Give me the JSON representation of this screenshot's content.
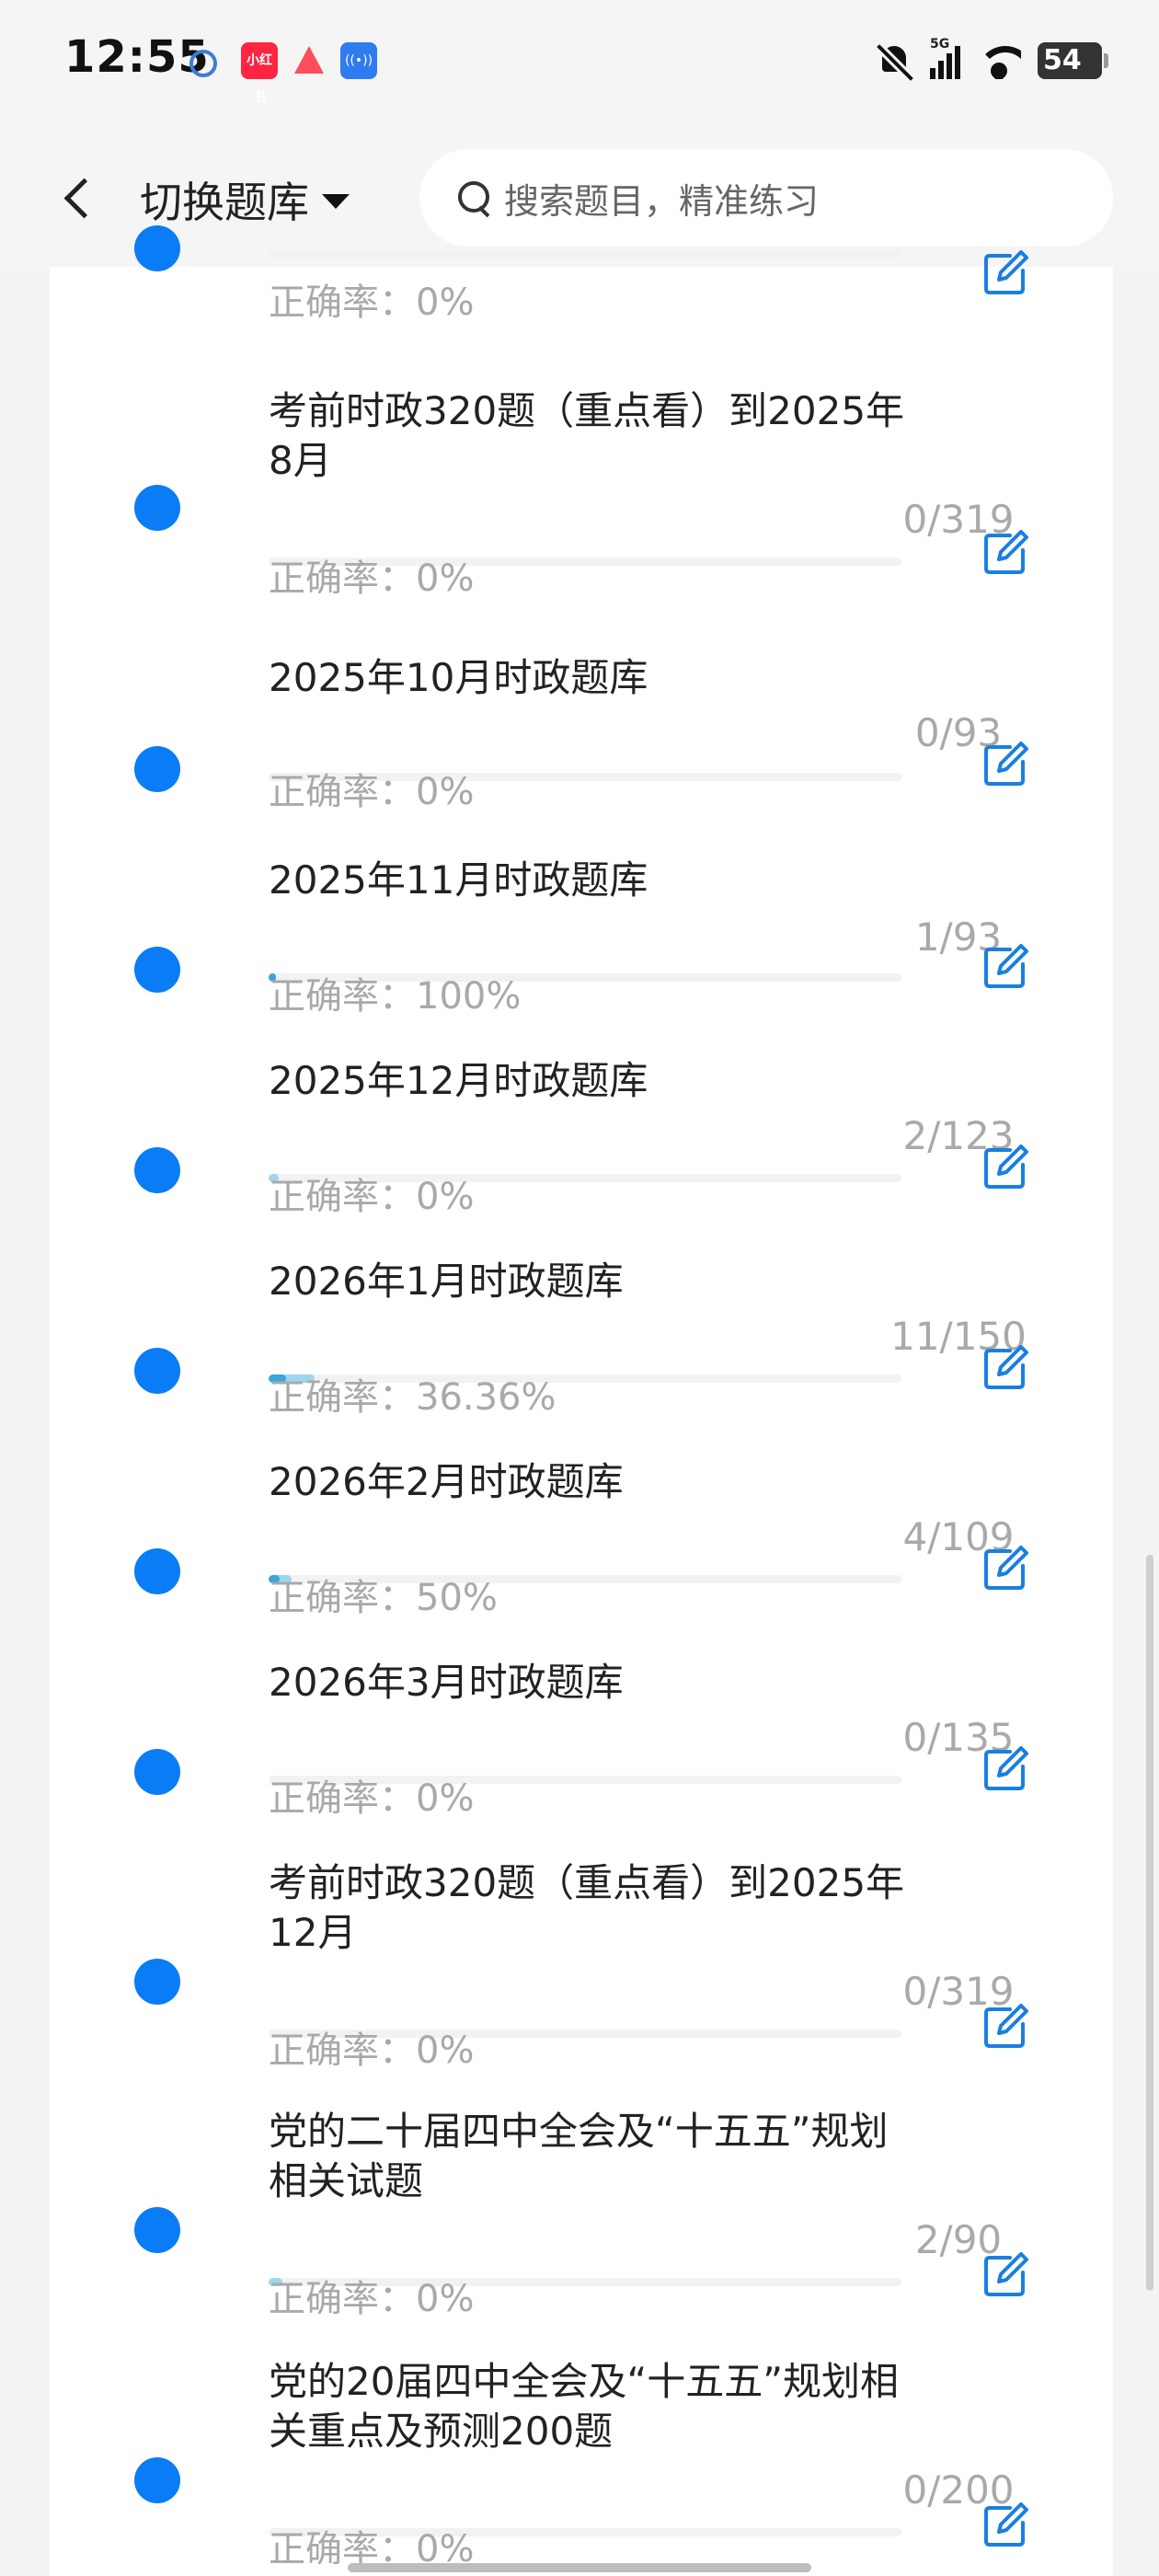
{
  "status_bar": {
    "time": "12:55",
    "app_icons": [
      "bubble-app-icon",
      "xiaohongshu-icon",
      "watermelon-app-icon",
      "hotspot-app-icon"
    ],
    "xiaohongshu_label": "小红书",
    "network": "5G",
    "battery": "54"
  },
  "header": {
    "title": "切换题库",
    "search_placeholder": "搜索题目，精准练习"
  },
  "colors": {
    "dot_blue": "#0a7cf5",
    "progress_light": "#9ed6ee",
    "progress_dark": "#3aa6da",
    "muted_text": "#a9a9a9"
  },
  "items": [
    {
      "title": "",
      "count": "",
      "accuracy": "正确率：0%",
      "progress": 0
    },
    {
      "title": "考前时政320题（重点看）到2025年8月",
      "count": "0/319",
      "accuracy": "正确率：0%",
      "progress": 0
    },
    {
      "title": "2025年10月时政题库",
      "count": "0/93",
      "accuracy": "正确率：0%",
      "progress": 0
    },
    {
      "title": "2025年11月时政题库",
      "count": "1/93",
      "accuracy": "正确率：100%",
      "progress": 0.011,
      "correct": 0.011
    },
    {
      "title": "2025年12月时政题库",
      "count": "2/123",
      "accuracy": "正确率：0%",
      "progress": 0.016
    },
    {
      "title": "2026年1月时政题库",
      "count": "11/150",
      "accuracy": "正确率：36.36%",
      "progress": 0.073,
      "correct": 0.027
    },
    {
      "title": "2026年2月时政题库",
      "count": "4/109",
      "accuracy": "正确率：50%",
      "progress": 0.037,
      "correct": 0.018
    },
    {
      "title": "2026年3月时政题库",
      "count": "0/135",
      "accuracy": "正确率：0%",
      "progress": 0
    },
    {
      "title": "考前时政320题（重点看）到2025年12月",
      "count": "0/319",
      "accuracy": "正确率：0%",
      "progress": 0
    },
    {
      "title": "党的二十届四中全会及“十五五”规划相关试题",
      "count": "2/90",
      "accuracy": "正确率：0%",
      "progress": 0.022
    },
    {
      "title": "党的20届四中全会及“十五五”规划相关重点及预测200题",
      "count": "0/200",
      "accuracy": "正确率：0%",
      "progress": 0
    }
  ]
}
